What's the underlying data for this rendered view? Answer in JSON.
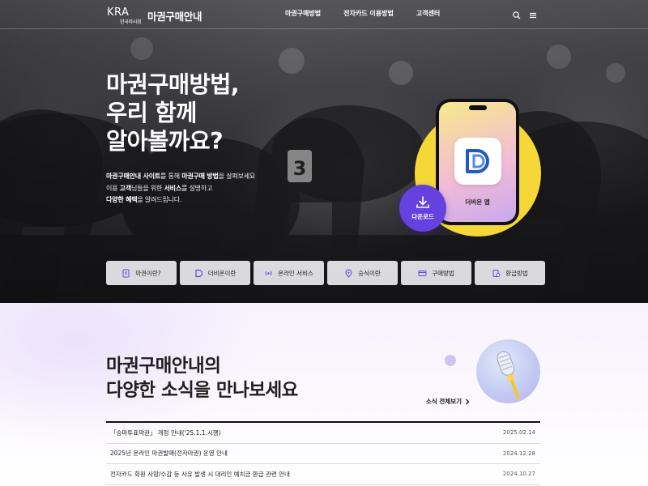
{
  "header": {
    "logo_mark": "KRA",
    "logo_sub": "한국마사회",
    "site_title": "마권구매안내",
    "nav": [
      "마권구매방법",
      "전자카드 이용방법",
      "고객센터"
    ],
    "icons": [
      "search-icon",
      "menu-icon"
    ]
  },
  "hero": {
    "title_lines": [
      "마권구매방법,",
      "우리 함께",
      "알아볼까요?"
    ],
    "desc": {
      "line1": [
        "마권구매안내 사이트",
        "를 통해 ",
        "마권구매 방법",
        "을 살펴보세요"
      ],
      "line2": [
        "이용 ",
        "고객",
        "님들을 위한 ",
        "서비스",
        "를 설명하고"
      ],
      "line3": [
        "다양한 혜택",
        "을 알려드립니다."
      ]
    },
    "app": {
      "name": "더비온 앱",
      "download_label": "다운로드",
      "accent_color": "#6542e0",
      "circle_color": "#f5d837"
    }
  },
  "quick_menu": [
    {
      "label": "마권이란?",
      "icon": "document-icon"
    },
    {
      "label": "더비온이란",
      "icon": "derby-on-logo-icon"
    },
    {
      "label": "온라인 서비스",
      "icon": "broadcast-icon"
    },
    {
      "label": "승식이란",
      "icon": "location-pin-icon"
    },
    {
      "label": "구매방법",
      "icon": "card-icon"
    },
    {
      "label": "환급방법",
      "icon": "coins-icon"
    }
  ],
  "news": {
    "title_line1_bold": "마권구매안내",
    "title_line1_rest": "의",
    "title_line2_pre": "다양한 ",
    "title_line2_bold": "소식",
    "title_line2_post": "을 만나보세요",
    "all_link": "소식 전체보기",
    "items": [
      {
        "title": "「승마투표약관」 개정 안내('25.1.1.시행)",
        "date": "2025.02.14"
      },
      {
        "title": "2025년 온라인 마권발매(전자마권) 운영 안내",
        "date": "2024.12.28"
      },
      {
        "title": "전자카드 회원 사망/수감 등 사유 발생 시 대리인 예치금 환급 관련 안내",
        "date": "2024.10.27"
      }
    ]
  }
}
